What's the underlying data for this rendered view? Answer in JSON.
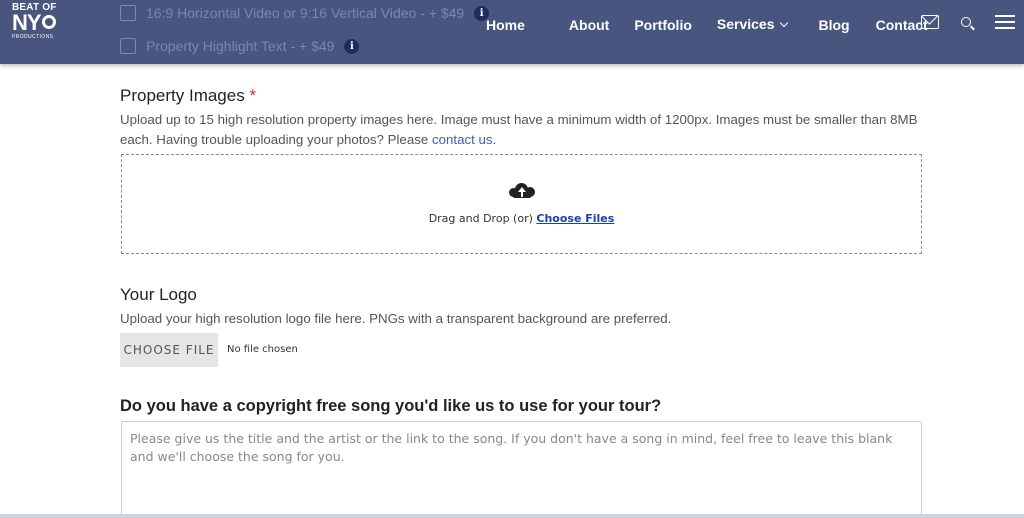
{
  "header": {
    "logo": {
      "line1": "BEAT OF",
      "line2": "NY",
      "line3": "PRODUCTIONS"
    },
    "addons": [
      {
        "label": "16:9 Horizontal Video or 9:16 Vertical Video - + $49"
      },
      {
        "label": "Property Highlight Text - + $49"
      }
    ],
    "nav": [
      "Home",
      "About",
      "Portfolio",
      "Services",
      "Blog",
      "Contact"
    ],
    "icons": [
      "mail-icon",
      "search-icon",
      "menu-icon"
    ],
    "color": "#48557f"
  },
  "property_images": {
    "title": "Property Images",
    "required_mark": "*",
    "desc_text": "Upload up to 15 high resolution property images here. Image must have a minimum width of 1200px. Images must be smaller than 8MB each. Having trouble uploading your photos? Please",
    "desc_link": "contact us",
    "desc_end": ".",
    "dropzone_text": "Drag and Drop (or)",
    "dropzone_link": "Choose Files"
  },
  "logo_upload": {
    "title": "Your Logo",
    "desc": "Upload your high resolution logo file here. PNGs with a transparent background are preferred.",
    "button": "CHOOSE FILE",
    "status": "No file chosen"
  },
  "song": {
    "title": "Do you have a copyright free song you'd like us to use for your tour?",
    "placeholder": "Please give us the title and the artist or the link to the song. If you don't have a song in mind, feel free to leave this blank and we'll choose the song for you."
  }
}
